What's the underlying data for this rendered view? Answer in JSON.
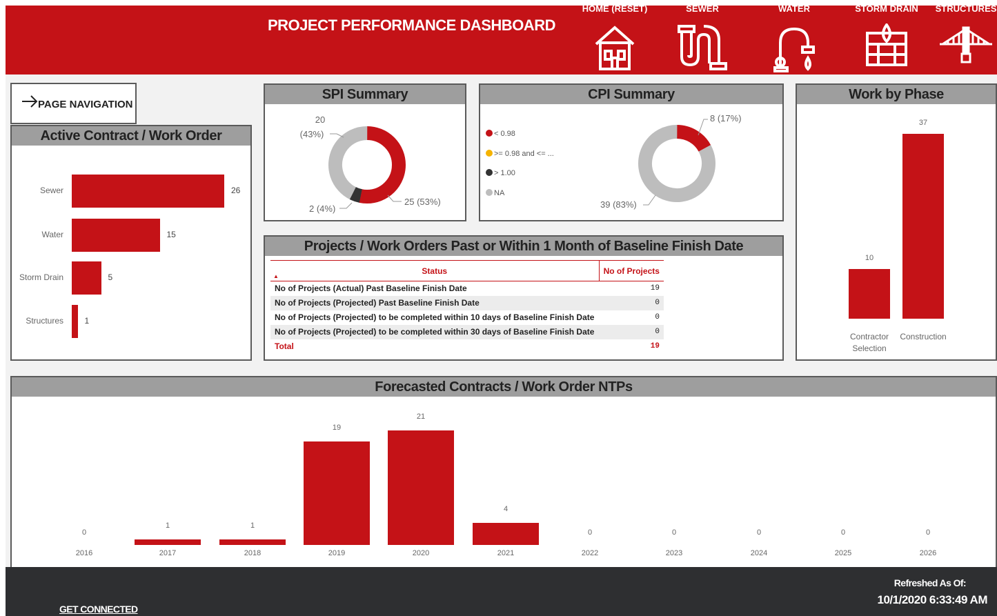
{
  "header": {
    "title": "PROJECT PERFORMANCE DASHBOARD",
    "nav": [
      {
        "label": "HOME (RESET)",
        "icon": "house-icon"
      },
      {
        "label": "SEWER",
        "icon": "sewer-pipe-icon"
      },
      {
        "label": "WATER",
        "icon": "faucet-icon"
      },
      {
        "label": "STORM DRAIN",
        "icon": "storm-drain-icon"
      },
      {
        "label": "STRUCTURES",
        "icon": "bridge-icon"
      }
    ]
  },
  "page_navigation": {
    "label": "PAGE NAVIGATION",
    "icon": "arrow-right-icon"
  },
  "active_contracts": {
    "title": "Active Contract / Work Order",
    "chart_data": {
      "type": "bar",
      "orientation": "horizontal",
      "categories": [
        "Sewer",
        "Water",
        "Storm Drain",
        "Structures"
      ],
      "values": [
        26,
        15,
        5,
        1
      ]
    }
  },
  "spi_summary": {
    "title": "SPI Summary",
    "chart_data": {
      "type": "pie",
      "donut": true,
      "slices": [
        {
          "label": "25 (53%)",
          "value": 25,
          "color": "#c41217"
        },
        {
          "label": "2 (4%)",
          "value": 2,
          "color": "#333333"
        },
        {
          "label_line1": "20",
          "label_line2": "(43%)",
          "value": 20,
          "color": "#bdbdbd"
        }
      ]
    }
  },
  "cpi_summary": {
    "title": "CPI Summary",
    "legend": [
      {
        "label": "< 0.98",
        "color": "#c41217"
      },
      {
        "label": ">= 0.98 and <= ...",
        "color": "#f5b300"
      },
      {
        "label": "> 1.00",
        "color": "#333333"
      },
      {
        "label": "NA",
        "color": "#bdbdbd"
      }
    ],
    "chart_data": {
      "type": "pie",
      "donut": true,
      "slices": [
        {
          "label": "8 (17%)",
          "value": 8,
          "color": "#c41217"
        },
        {
          "label": "39 (83%)",
          "value": 39,
          "color": "#bdbdbd"
        }
      ]
    }
  },
  "work_by_phase": {
    "title": "Work by Phase",
    "chart_data": {
      "type": "bar",
      "categories": [
        [
          "Contractor",
          "Selection"
        ],
        [
          "Construction"
        ]
      ],
      "values": [
        10,
        37
      ]
    }
  },
  "baseline_table": {
    "title": "Projects / Work Orders Past or Within 1 Month of Baseline Finish Date",
    "columns": [
      "Status",
      "No of Projects"
    ],
    "rows": [
      [
        "No of Projects (Actual) Past Baseline Finish Date",
        "19"
      ],
      [
        "No of Projects (Projected) Past Baseline Finish Date",
        "0"
      ],
      [
        "No of Projects (Projected) to be completed within 10 days of Baseline Finish Date",
        "0"
      ],
      [
        "No of Projects (Projected) to be completed within 30 days of Baseline Finish Date",
        "0"
      ]
    ],
    "total": [
      "Total",
      "19"
    ]
  },
  "forecast": {
    "title": "Forecasted Contracts / Work Order NTPs",
    "chart_data": {
      "type": "bar",
      "categories": [
        "2016",
        "2017",
        "2018",
        "2019",
        "2020",
        "2021",
        "2022",
        "2023",
        "2024",
        "2025",
        "2026"
      ],
      "values": [
        0,
        1,
        1,
        19,
        21,
        4,
        0,
        0,
        0,
        0,
        0
      ]
    }
  },
  "footer": {
    "get_connected": "GET CONNECTED",
    "refreshed_label": "Refreshed As Of:",
    "refreshed_value": "10/1/2020 6:33:49 AM"
  },
  "colors": {
    "brand_red": "#c41217",
    "header_gray": "#9e9e9e",
    "footer": "#2e2f31"
  }
}
